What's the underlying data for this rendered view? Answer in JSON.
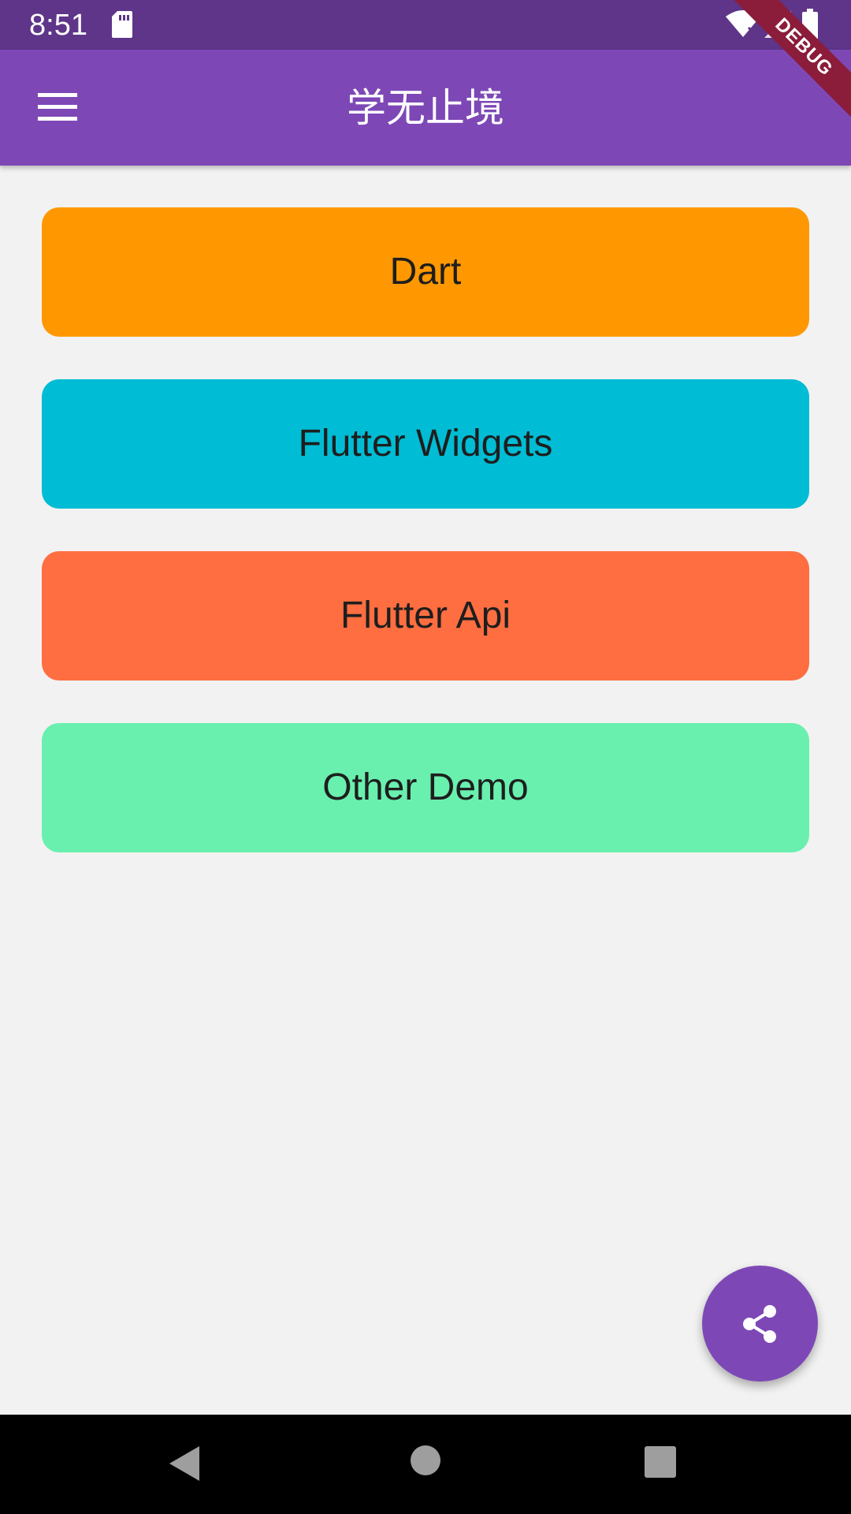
{
  "status_bar": {
    "time": "8:51",
    "icons": [
      "sd-card-icon",
      "wifi-off-icon",
      "signal-icon",
      "battery-icon"
    ]
  },
  "app_bar": {
    "title": "学无止境",
    "menu_icon": "menu-icon"
  },
  "debug_banner": {
    "label": "DEBUG"
  },
  "menu": {
    "items": [
      {
        "label": "Dart",
        "color": "#ff9800"
      },
      {
        "label": "Flutter Widgets",
        "color": "#00bcd4"
      },
      {
        "label": "Flutter Api",
        "color": "#ff6e40"
      },
      {
        "label": "Other Demo",
        "color": "#69f0ae"
      }
    ]
  },
  "fab": {
    "icon": "share-icon",
    "color": "#7d48b6"
  },
  "nav_bar": {
    "icons": [
      "back-icon",
      "home-icon",
      "recents-icon"
    ]
  },
  "colors": {
    "status_bar": "#5e3589",
    "app_bar": "#7d48b6",
    "background": "#f2f2f2"
  }
}
